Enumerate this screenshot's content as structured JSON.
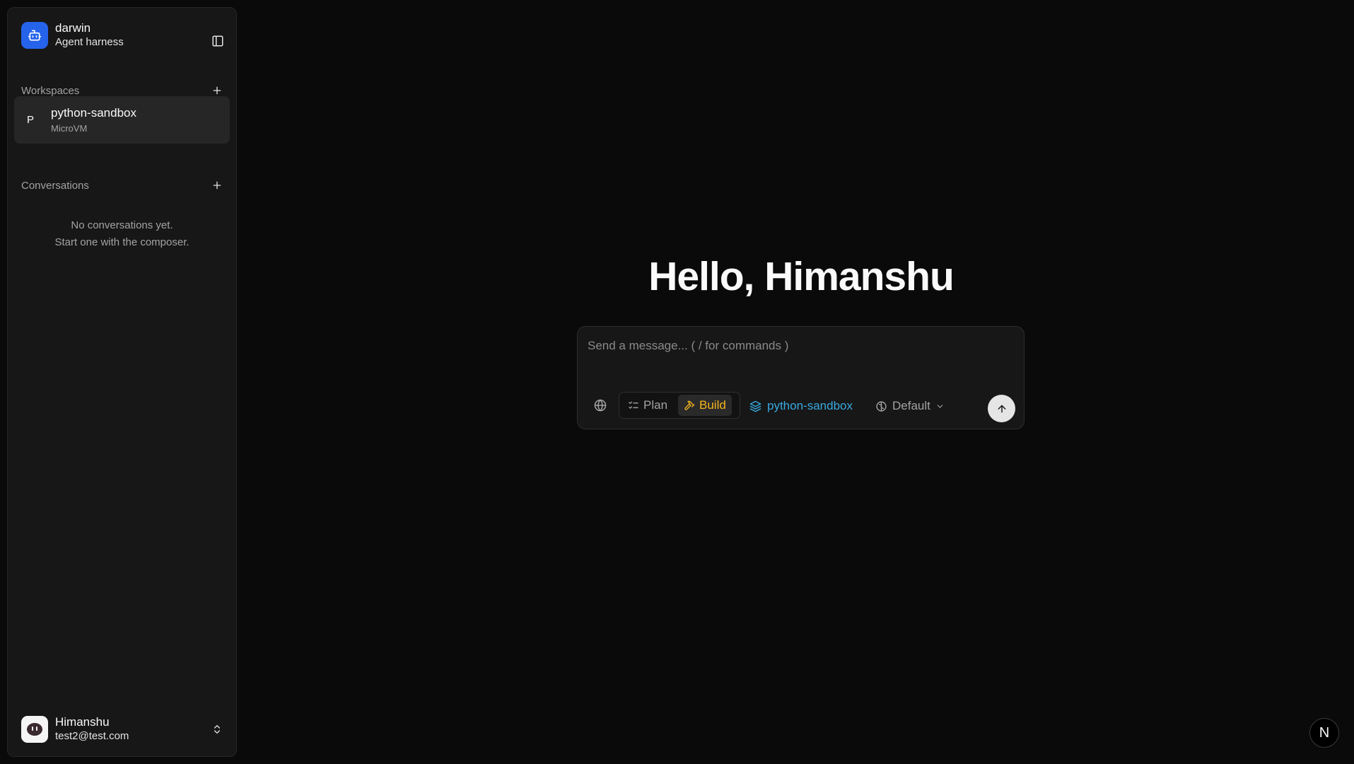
{
  "app": {
    "name": "darwin",
    "subtitle": "Agent harness"
  },
  "sidebar": {
    "workspaces_title": "Workspaces",
    "workspaces": [
      {
        "initial": "P",
        "name": "python-sandbox",
        "type": "MicroVM"
      }
    ],
    "conversations_title": "Conversations",
    "empty_line1": "No conversations yet.",
    "empty_line2": "Start one with the composer."
  },
  "user": {
    "name": "Himanshu",
    "email": "test2@test.com"
  },
  "main": {
    "greeting": "Hello, Himanshu",
    "composer": {
      "placeholder": "Send a message... ( / for commands )",
      "value": "",
      "modes": [
        "Plan",
        "Build"
      ],
      "active_mode": "Build",
      "workspace": "python-sandbox",
      "model": "Default"
    }
  },
  "badge": {
    "label": "N"
  },
  "colors": {
    "accent_blue": "#2563eb",
    "build_active": "#f5b41d",
    "workspace_link": "#38a9e0"
  }
}
